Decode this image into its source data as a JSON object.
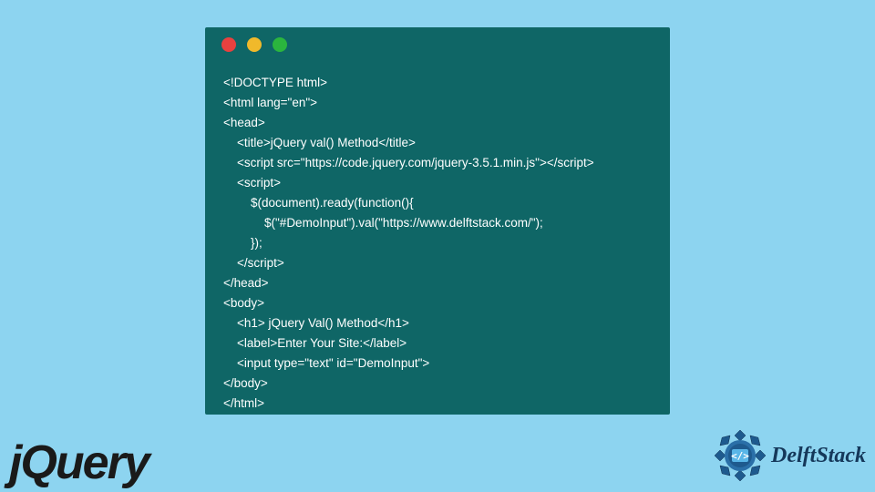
{
  "code": {
    "lines": [
      "<!DOCTYPE html>",
      "<html lang=\"en\">",
      "<head>",
      "    <title>jQuery val() Method</title>",
      "    <script src=\"https://code.jquery.com/jquery-3.5.1.min.js\"></script>",
      "    <script>",
      "        $(document).ready(function(){",
      "            $(\"#DemoInput\").val(\"https://www.delftstack.com/\");",
      "        });",
      "    </script>",
      "</head>",
      "<body>",
      "    <h1> jQuery Val() Method</h1>",
      "    <label>Enter Your Site:</label>",
      "    <input type=\"text\" id=\"DemoInput\">",
      "</body>",
      "</html>"
    ]
  },
  "logos": {
    "jquery": "jQuery",
    "delftstack": "DelftStack"
  }
}
